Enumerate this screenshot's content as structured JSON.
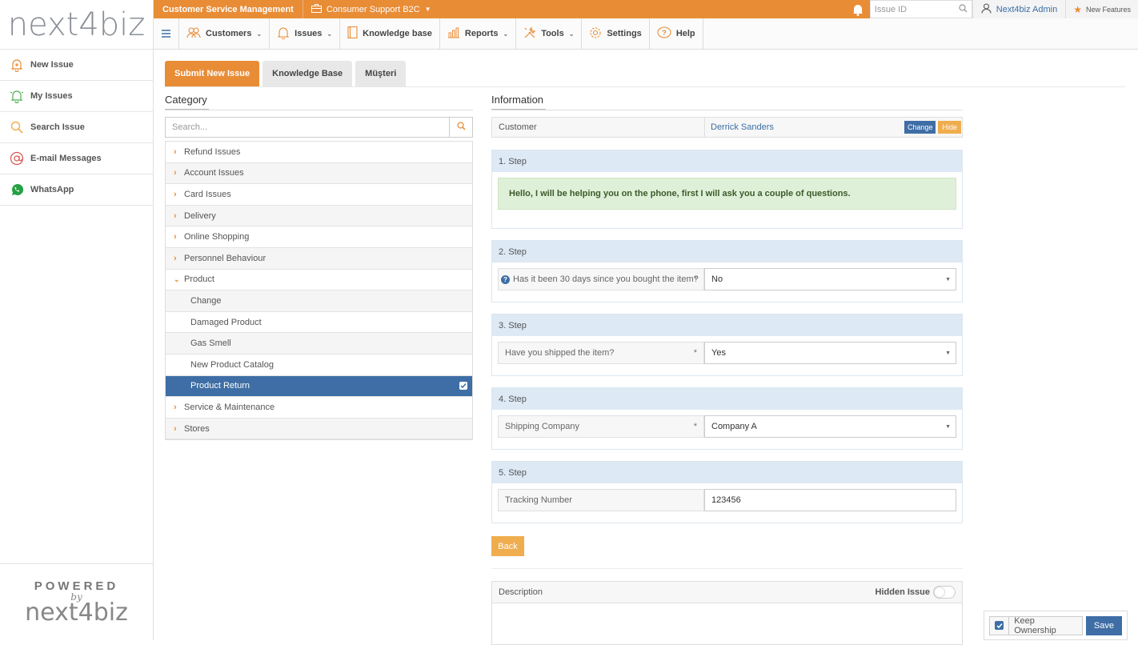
{
  "brand": {
    "logo_text": "next4biz",
    "powered": "POWERED",
    "by": "by",
    "powered_logo": "next4biz"
  },
  "sidebar": {
    "items": [
      {
        "label": "New Issue",
        "icon": "bell-plus-icon"
      },
      {
        "label": "My Issues",
        "icon": "bell-user-icon"
      },
      {
        "label": "Search Issue",
        "icon": "search-icon"
      },
      {
        "label": "E-mail Messages",
        "icon": "at-icon"
      },
      {
        "label": "WhatsApp",
        "icon": "whatsapp-icon"
      }
    ]
  },
  "topbar": {
    "app": "Customer Service Management",
    "workspace": "Consumer Support B2C",
    "issue_id_placeholder": "Issue ID",
    "user": "Next4biz Admin",
    "new_features": "New Features"
  },
  "nav": {
    "items": [
      {
        "label": "Customers",
        "icon": "users-icon",
        "dropdown": true
      },
      {
        "label": "Issues",
        "icon": "bell-icon",
        "dropdown": true
      },
      {
        "label": "Knowledge base",
        "icon": "book-icon",
        "dropdown": false
      },
      {
        "label": "Reports",
        "icon": "chart-icon",
        "dropdown": true
      },
      {
        "label": "Tools",
        "icon": "tools-icon",
        "dropdown": true
      },
      {
        "label": "Settings",
        "icon": "gear-icon",
        "dropdown": false
      },
      {
        "label": "Help",
        "icon": "help-icon",
        "dropdown": false
      }
    ]
  },
  "tabs": [
    "Submit New Issue",
    "Knowledge Base",
    "Müşteri"
  ],
  "category": {
    "title": "Category",
    "search_placeholder": "Search...",
    "items": [
      {
        "label": "Refund Issues",
        "type": "closed"
      },
      {
        "label": "Account Issues",
        "type": "closed"
      },
      {
        "label": "Card Issues",
        "type": "closed"
      },
      {
        "label": "Delivery",
        "type": "closed"
      },
      {
        "label": "Online Shopping",
        "type": "closed"
      },
      {
        "label": "Personnel Behaviour",
        "type": "closed"
      },
      {
        "label": "Product",
        "type": "open"
      },
      {
        "label": "Change",
        "type": "sub"
      },
      {
        "label": "Damaged Product",
        "type": "sub"
      },
      {
        "label": "Gas Smell",
        "type": "sub"
      },
      {
        "label": "New Product Catalog",
        "type": "sub"
      },
      {
        "label": "Product Return",
        "type": "selected"
      },
      {
        "label": "Service & Maintenance",
        "type": "closed"
      },
      {
        "label": "Stores",
        "type": "closed"
      }
    ]
  },
  "information": {
    "title": "Information",
    "customer_label": "Customer",
    "customer_value": "Derrick Sanders",
    "change": "Change",
    "hide": "Hide"
  },
  "steps": {
    "s1": {
      "title": "1. Step",
      "message": "Hello, I will be helping you on the phone, first I will ask you a couple of questions."
    },
    "s2": {
      "title": "2. Step",
      "question": "Has it been 30 days since you bought the item?",
      "answer": "No"
    },
    "s3": {
      "title": "3. Step",
      "question": "Have you shipped the item?",
      "answer": "Yes"
    },
    "s4": {
      "title": "4. Step",
      "question": "Shipping Company",
      "answer": "Company A"
    },
    "s5": {
      "title": "5. Step",
      "question": "Tracking Number",
      "answer": "123456"
    }
  },
  "back": "Back",
  "description": {
    "label": "Description",
    "hidden_issue": "Hidden Issue"
  },
  "footer": {
    "keep_ownership": "Keep Ownership",
    "save": "Save"
  },
  "colors": {
    "accent": "#e98c36",
    "primary": "#3e6ea5",
    "warning": "#f0ad4e",
    "step_header": "#dde9f5",
    "success_bg": "#dff0d8"
  }
}
